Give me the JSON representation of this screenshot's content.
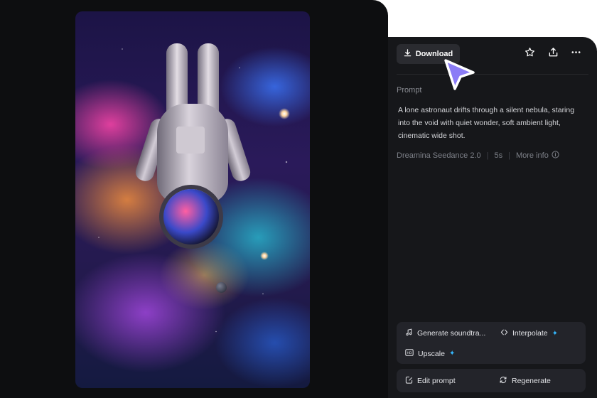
{
  "toolbar": {
    "download_label": "Download"
  },
  "details": {
    "prompt_label": "Prompt",
    "prompt_text": "A lone astronaut drifts through a silent nebula, staring into the void with quiet wonder, soft ambient light, cinematic wide shot.",
    "model": "Dreamina Seedance 2.0",
    "duration": "5s",
    "more_info_label": "More info"
  },
  "actions": {
    "generate_soundtrack": "Generate soundtra...",
    "interpolate": "Interpolate",
    "upscale": "Upscale",
    "edit_prompt": "Edit prompt",
    "regenerate": "Regenerate"
  },
  "icons": {
    "download": "download-icon",
    "star": "star-icon",
    "share": "share-icon",
    "more": "more-icon",
    "info": "info-icon",
    "music": "music-note-icon",
    "interpolate": "interpolate-icon",
    "upscale": "upscale-icon",
    "edit": "edit-icon",
    "regenerate": "regenerate-icon",
    "sparkle": "sparkle-icon",
    "cursor": "cursor-icon"
  },
  "colors": {
    "accent": "#34b8ff",
    "cursor": "#8b7cf6"
  }
}
